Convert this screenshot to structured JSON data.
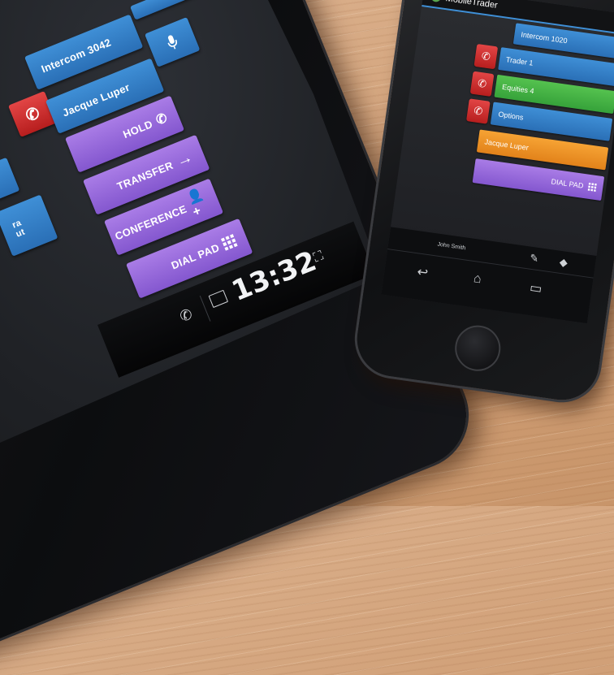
{
  "tablet": {
    "buttons": {
      "intercom": "Intercom 3042",
      "jacque": "Jacque Luper",
      "hold": "HOLD",
      "transfer": "TRANSFER",
      "conference": "CONFERENCE",
      "dialpad": "DIAL PAD",
      "partial_left_line1": "ra",
      "partial_left_line2": "ut"
    },
    "clock": "13:32"
  },
  "phone": {
    "app_title": "MobileTrader",
    "buttons": [
      "Intercom 1020",
      "Trader 1",
      "Equities 4",
      "Options",
      "Jacque Luper",
      "DIAL PAD"
    ],
    "user_name": "John Smith"
  },
  "colors": {
    "blue": "#2f7cc8",
    "purple": "#9468d9",
    "red": "#d33333",
    "green": "#46b545",
    "orange": "#f0921f",
    "wood": "#d2a27a"
  }
}
